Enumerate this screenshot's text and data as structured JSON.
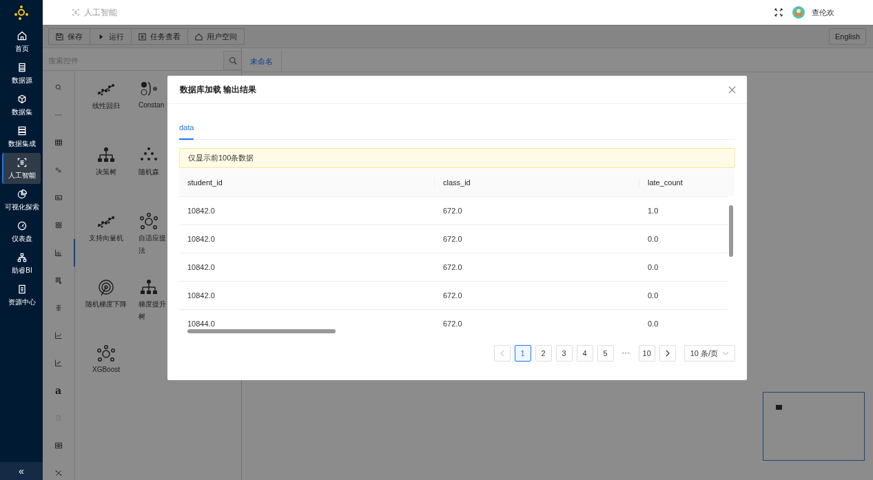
{
  "sidebar": {
    "items": [
      {
        "label": "首页",
        "selected": false
      },
      {
        "label": "数据源",
        "selected": false
      },
      {
        "label": "数据集",
        "selected": false
      },
      {
        "label": "数据集成",
        "selected": false
      },
      {
        "label": "人工智能",
        "selected": true
      },
      {
        "label": "可视化探索",
        "selected": false
      },
      {
        "label": "仪表盘",
        "selected": false
      },
      {
        "label": "助睿BI",
        "selected": false
      },
      {
        "label": "资源中心",
        "selected": false
      }
    ],
    "collapse": "«"
  },
  "header": {
    "breadcrumb": "人工智能",
    "user": "查伦欢"
  },
  "toolbar": {
    "buttons": [
      "保存",
      "运行",
      "任务查看",
      "用户空间"
    ],
    "language": "English"
  },
  "palette": {
    "search": {
      "placeholder": "搜索控件"
    },
    "categories": [
      {
        "selected": false
      },
      {
        "selected": false
      },
      {
        "selected": false
      },
      {
        "selected": false
      },
      {
        "selected": false
      },
      {
        "selected": false
      },
      {
        "selected": true
      },
      {
        "selected": false
      },
      {
        "selected": false
      },
      {
        "selected": false
      },
      {
        "selected": false
      },
      {
        "label": "a",
        "selected": false
      },
      {
        "selected": false
      },
      {
        "selected": false
      },
      {
        "selected": false
      }
    ],
    "components": [
      {
        "lines": [
          "线性回归"
        ]
      },
      {
        "lines": [
          "Constan"
        ]
      },
      {
        "lines": [
          "决策树"
        ]
      },
      {
        "lines": [
          "随机森"
        ]
      },
      {
        "lines": [
          "支持向量机"
        ]
      },
      {
        "lines": [
          "自适应提",
          "法"
        ]
      },
      {
        "lines": [
          "随机梯度下降"
        ]
      },
      {
        "lines": [
          "梯度提升",
          "树"
        ]
      },
      {
        "lines": [
          "XGBoost"
        ]
      }
    ]
  },
  "canvas": {
    "tabs": [
      {
        "label": "未命名",
        "selected": true
      }
    ]
  },
  "dialog": {
    "title": "数据库加载 输出结果",
    "tabs": [
      {
        "label": "data",
        "selected": true
      }
    ],
    "notice": "仅显示前100条数据",
    "table": {
      "columns": [
        "student_id",
        "class_id",
        "late_count"
      ],
      "rows": [
        [
          "10842.0",
          "672.0",
          "1.0"
        ],
        [
          "10842.0",
          "672.0",
          "0.0"
        ],
        [
          "10842.0",
          "672.0",
          "0.0"
        ],
        [
          "10842.0",
          "672.0",
          "0.0"
        ],
        [
          "10844.0",
          "672.0",
          "0.0"
        ]
      ]
    },
    "pagination": {
      "pages": [
        {
          "kind": "page",
          "label": "1",
          "selected": true
        },
        {
          "kind": "page",
          "label": "2",
          "selected": false
        },
        {
          "kind": "page",
          "label": "3",
          "selected": false
        },
        {
          "kind": "page",
          "label": "4",
          "selected": false
        },
        {
          "kind": "page",
          "label": "5",
          "selected": false
        },
        {
          "kind": "ellipsis",
          "label": "•••"
        },
        {
          "kind": "page",
          "label": "10",
          "selected": false
        }
      ],
      "page_size": "10 条/页"
    }
  }
}
